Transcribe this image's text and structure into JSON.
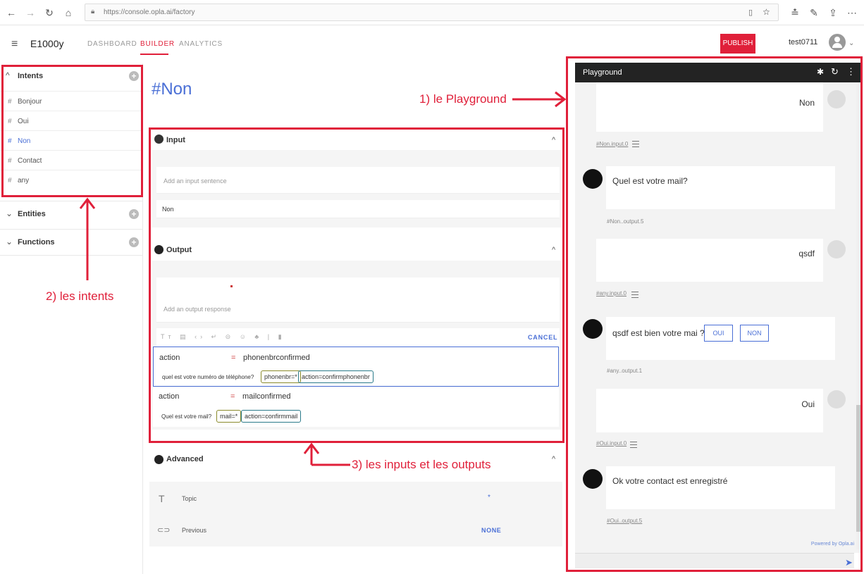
{
  "browser": {
    "url": "https://console.opla.ai/factory"
  },
  "header": {
    "app_title": "E1000y",
    "tabs": [
      "DASHBOARD",
      "BUILDER",
      "ANALYTICS"
    ],
    "publish_label": "PUBLISH",
    "username": "test0711"
  },
  "sidebar": {
    "intents_title": "Intents",
    "intents": [
      "Bonjour",
      "Oui",
      "Non",
      "Contact",
      "any"
    ],
    "entities_title": "Entities",
    "functions_title": "Functions"
  },
  "main": {
    "title": "#Non",
    "input_title": "Input",
    "input_placeholder": "Add an input sentence",
    "input_value": "Non",
    "output_title": "Output",
    "output_placeholder": "Add an output response",
    "cancel_label": "CANCEL",
    "outputs": [
      {
        "key": "action",
        "eq": "=",
        "value": "phonenbrconfirmed",
        "sentence": "quel est votre numéro de téléphone?",
        "tag1": "phonenbr=*",
        "tag2": "action=confirmphonenbr"
      },
      {
        "key": "action",
        "eq": "=",
        "value": "mailconfirmed",
        "sentence": "Quel est votre mail?",
        "tag1": "mail=*",
        "tag2": "action=confirmmail"
      }
    ],
    "advanced_title": "Advanced",
    "topic_label": "Topic",
    "topic_value": "*",
    "previous_label": "Previous",
    "previous_value": "NONE"
  },
  "playground": {
    "title": "Playground",
    "messages": [
      {
        "from": "user",
        "text": "Non",
        "meta": "#Non.input.0"
      },
      {
        "from": "bot",
        "text": "Quel est votre mail?",
        "meta": "#Non..output.5"
      },
      {
        "from": "user",
        "text": "qsdf",
        "meta": "#any.input.0"
      },
      {
        "from": "bot",
        "text": "qsdf est bien votre mai ?",
        "meta": "#any..output.1",
        "buttons": [
          "OUI",
          "NON"
        ]
      },
      {
        "from": "user",
        "text": "Oui",
        "meta": "#Oui.input.0"
      },
      {
        "from": "bot",
        "text": "Ok votre contact est enregistré",
        "meta": "#Oui..output.5"
      }
    ],
    "powered_by": "Powered by Opla.ai"
  },
  "annotations": {
    "a1": "1) le Playground",
    "a2": "2) les intents",
    "a3": "3) les inputs et les outputs"
  },
  "colors": {
    "accent": "#e0203a",
    "link": "#4a6fd6",
    "dark": "#232323"
  }
}
